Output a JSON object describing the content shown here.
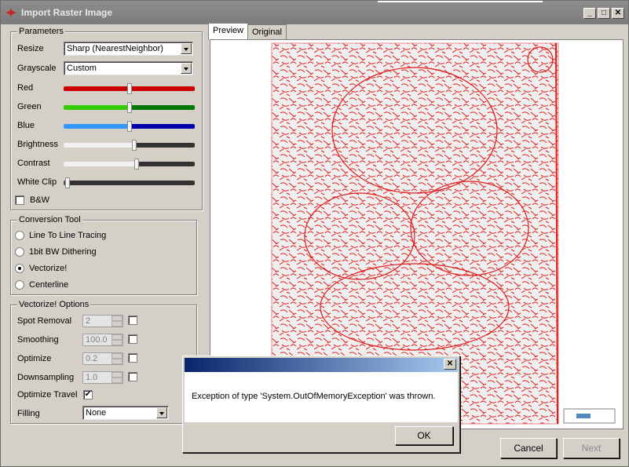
{
  "window": {
    "title": "Import Raster Image"
  },
  "parameters": {
    "label": "Parameters",
    "resize_label": "Resize",
    "resize_value": "Sharp (NearestNeighbor)",
    "grayscale_label": "Grayscale",
    "grayscale_value": "Custom",
    "sliders": [
      {
        "label": "Red",
        "level": 0.5,
        "left_color": "#cc0000",
        "right_color": "#cc0000"
      },
      {
        "label": "Green",
        "level": 0.5,
        "left_color": "#33cc00",
        "right_color": "#007700"
      },
      {
        "label": "Blue",
        "level": 0.5,
        "left_color": "#3399ff",
        "right_color": "#0000aa"
      },
      {
        "label": "Brightness",
        "level": 0.54,
        "left_color": "#f0f0f0",
        "right_color": "#333333"
      },
      {
        "label": "Contrast",
        "level": 0.56,
        "left_color": "#f0f0f0",
        "right_color": "#333333"
      },
      {
        "label": "White Clip",
        "level": 0.01,
        "left_color": "#555555",
        "right_color": "#333333"
      }
    ],
    "bw_label": "B&W",
    "bw_checked": false
  },
  "conversion_tool": {
    "label": "Conversion Tool",
    "options": [
      {
        "label": "Line To Line Tracing",
        "selected": false
      },
      {
        "label": "1bit BW Dithering",
        "selected": false
      },
      {
        "label": "Vectorize!",
        "selected": true
      },
      {
        "label": "Centerline",
        "selected": false
      }
    ]
  },
  "vectorize_options": {
    "label": "Vectorize! Options",
    "rows": [
      {
        "label": "Spot Removal",
        "value": "2"
      },
      {
        "label": "Smoothing",
        "value": "100.0"
      },
      {
        "label": "Optimize",
        "value": "0.2"
      },
      {
        "label": "Downsampling",
        "value": "1.0"
      }
    ],
    "optimize_travel_label": "Optimize Travel",
    "optimize_travel_checked": true,
    "filling_label": "Filling",
    "filling_value": "None"
  },
  "tabs": [
    {
      "label": "Preview",
      "active": true
    },
    {
      "label": "Original",
      "active": false
    }
  ],
  "buttons": {
    "cancel": "Cancel",
    "next": "Next"
  },
  "dialog": {
    "message": "Exception of type 'System.OutOfMemoryException' was thrown.",
    "ok_label": "OK",
    "close_glyph": "✕"
  },
  "titlebar_buttons": {
    "minimize": "_",
    "maximize": "□",
    "close": "✕"
  }
}
